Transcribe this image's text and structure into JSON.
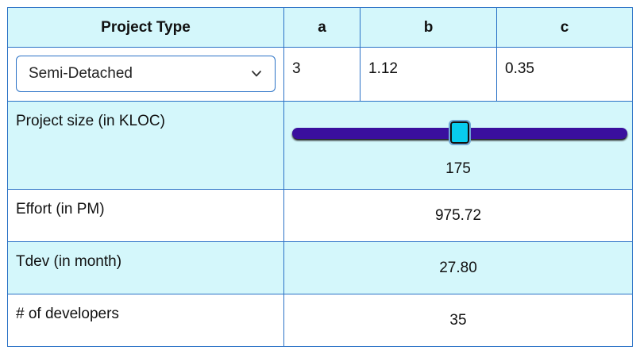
{
  "header": {
    "project_type": "Project Type",
    "a": "a",
    "b": "b",
    "c": "c"
  },
  "project_type_select": {
    "selected": "Semi-Detached"
  },
  "coefficients": {
    "a": "3",
    "b": "1.12",
    "c": "0.35"
  },
  "project_size": {
    "label": "Project size (in KLOC)",
    "value": "175",
    "slider_fraction": 0.5
  },
  "effort": {
    "label": "Effort (in PM)",
    "value": "975.72"
  },
  "tdev": {
    "label": "Tdev (in month)",
    "value": "27.80"
  },
  "developers": {
    "label": "# of developers",
    "value": "35"
  },
  "colors": {
    "border": "#2a72c6",
    "cyan_background": "#d4f7fb",
    "slider_track": "#3a0f9e",
    "slider_thumb": "#08ccee"
  }
}
